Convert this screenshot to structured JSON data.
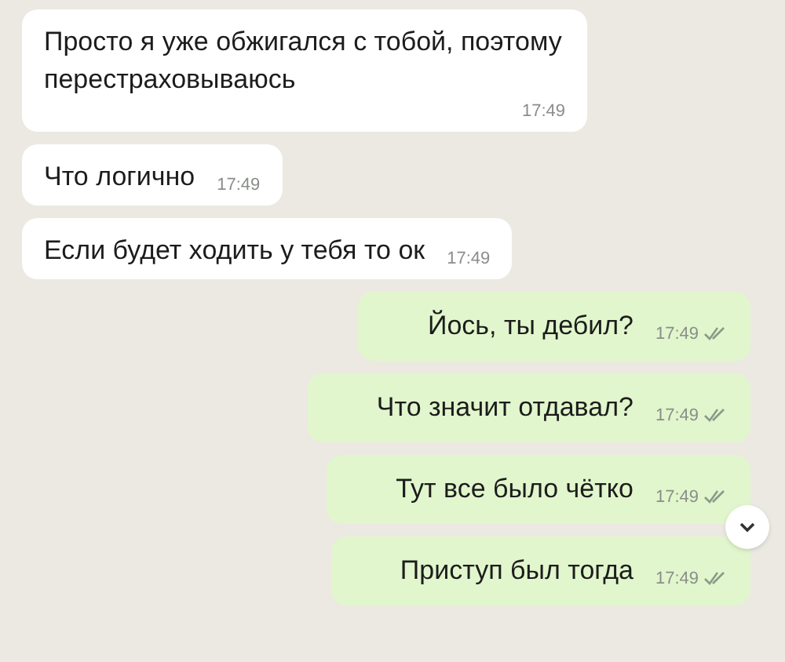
{
  "messages": [
    {
      "kind": "incoming",
      "text": "Просто я уже обжигался с тобой, поэтому перестраховываюсь",
      "time": "17:49"
    },
    {
      "kind": "incoming",
      "text": "Что логично",
      "time": "17:49"
    },
    {
      "kind": "incoming",
      "text": "Если будет ходить у тебя то ок",
      "time": "17:49"
    },
    {
      "kind": "outgoing",
      "text": "Йось, ты дебил?",
      "time": "17:49",
      "read": true
    },
    {
      "kind": "outgoing",
      "text": "Что значит отдавал?",
      "time": "17:49",
      "read": true
    },
    {
      "kind": "outgoing",
      "text": "Тут все было чётко",
      "time": "17:49",
      "read": true
    },
    {
      "kind": "outgoing",
      "text": "Приступ был тогда",
      "time": "17:49",
      "read": true
    }
  ]
}
